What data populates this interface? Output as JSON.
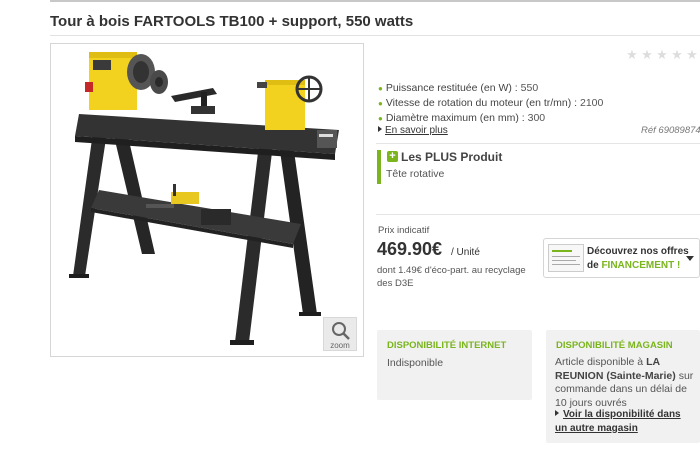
{
  "product": {
    "title": "Tour à bois FARTOOLS TB100 + support, 550 watts",
    "rating_stars": 5,
    "rating_value": 0
  },
  "image": {
    "zoom_label": "zoom",
    "zoom_icon": "magnifier-icon"
  },
  "specs": [
    {
      "label": "Puissance restituée (en W) :",
      "value": "550"
    },
    {
      "label": "Vitesse de rotation du moteur (en tr/mn) :",
      "value": "2100"
    },
    {
      "label": "Diamètre maximum (en mm) :",
      "value": "300"
    }
  ],
  "links": {
    "more_info": "En savoir plus",
    "reference": "Réf 69089874"
  },
  "plus": {
    "title": "Les PLUS Produit",
    "feature": "Tête rotative",
    "icon": "plus-icon"
  },
  "price": {
    "label": "Prix indicatif",
    "amount": "469.90€",
    "unit": "/ Unité",
    "eco_note": "dont 1.49€ d'éco-part. au recyclage des D3E"
  },
  "finance": {
    "line1": "Découvrez nos offres",
    "line2_prefix": "de",
    "line2_strong": "FINANCEMENT !"
  },
  "availability": {
    "internet": {
      "title": "DISPONIBILITÉ INTERNET",
      "status": "Indisponible"
    },
    "store": {
      "title": "DISPONIBILITÉ MAGASIN",
      "text_before": "Article disponible à",
      "store_name": "LA REUNION (Sainte-Marie)",
      "text_after": "sur commande dans un délai de 10 jours ouvrés",
      "link": "Voir la disponibilité dans un autre magasin"
    }
  },
  "colors": {
    "accent_green": "#7ab51d",
    "machine_yellow": "#f2d21f",
    "frame_dark": "#2b2b2b"
  }
}
